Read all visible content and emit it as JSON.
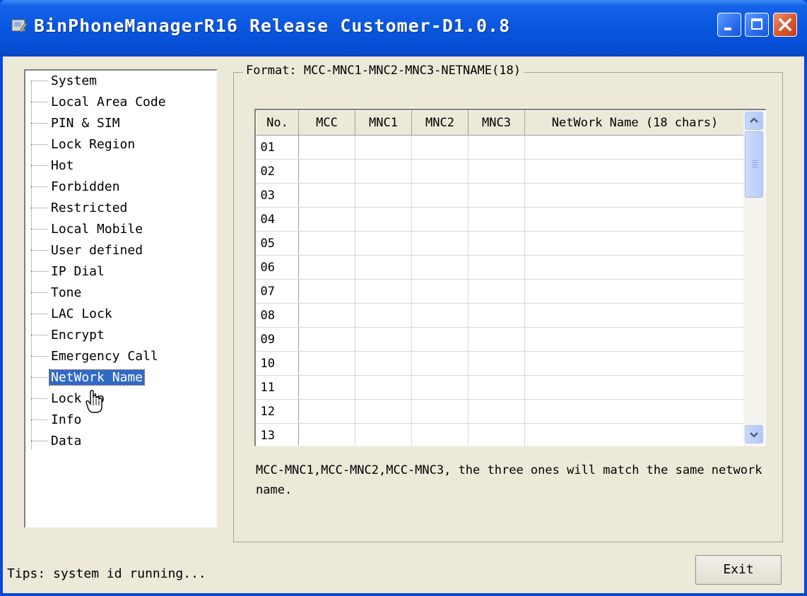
{
  "window": {
    "title": "BinPhoneManagerR16 Release Customer-D1.0.8"
  },
  "tree": {
    "items": [
      {
        "label": "System"
      },
      {
        "label": "Local Area Code"
      },
      {
        "label": "PIN & SIM"
      },
      {
        "label": "Lock Region"
      },
      {
        "label": "Hot"
      },
      {
        "label": "Forbidden"
      },
      {
        "label": "Restricted"
      },
      {
        "label": "Local Mobile"
      },
      {
        "label": "User defined"
      },
      {
        "label": "IP Dial"
      },
      {
        "label": "Tone"
      },
      {
        "label": "LAC Lock"
      },
      {
        "label": "Encrypt"
      },
      {
        "label": "Emergency Call"
      },
      {
        "label": "NetWork Name",
        "selected": true
      },
      {
        "label": "Lock Up"
      },
      {
        "label": "Info"
      },
      {
        "label": "Data"
      }
    ]
  },
  "group": {
    "title": "Format: MCC-MNC1-MNC2-MNC3-NETNAME(18)"
  },
  "grid": {
    "columns": [
      "No.",
      "MCC",
      "MNC1",
      "MNC2",
      "MNC3",
      "NetWork Name (18 chars)"
    ],
    "rows": [
      "01",
      "02",
      "03",
      "04",
      "05",
      "06",
      "07",
      "08",
      "09",
      "10",
      "11",
      "12",
      "13"
    ]
  },
  "note": "MCC-MNC1,MCC-MNC2,MCC-MNC3, the three ones will match the same network name.",
  "status": {
    "tips": "Tips: system id running..."
  },
  "buttons": {
    "exit": "Exit"
  },
  "colors": {
    "titlebar": "#0a58e0",
    "selection": "#316ac5",
    "face": "#ece9d8"
  }
}
